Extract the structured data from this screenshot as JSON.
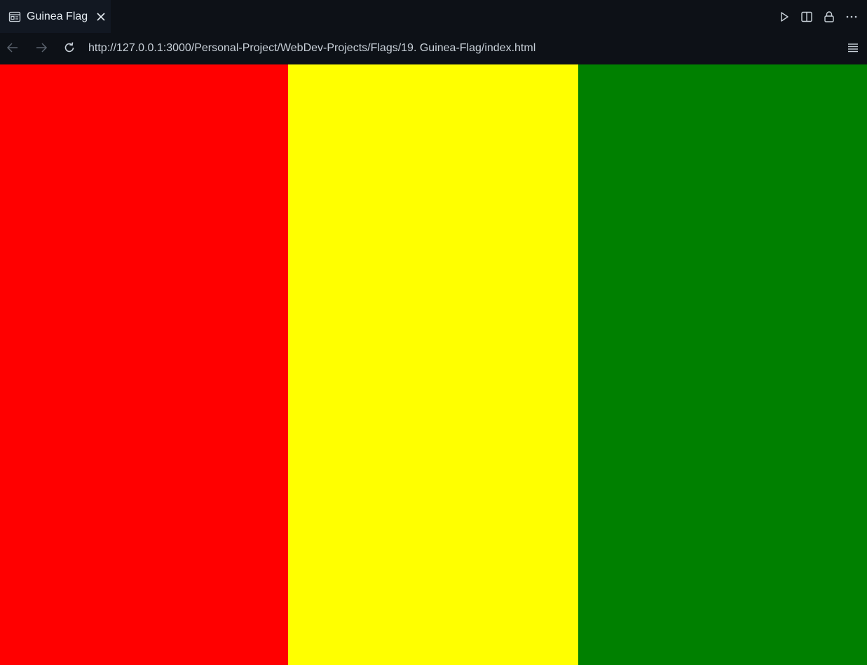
{
  "tab": {
    "title": "Guinea Flag",
    "icon": "preview-icon",
    "close_icon": "close-icon"
  },
  "tab_actions": [
    {
      "name": "run-icon"
    },
    {
      "name": "split-editor-icon"
    },
    {
      "name": "lock-icon"
    },
    {
      "name": "more-icon"
    }
  ],
  "nav": {
    "back_icon": "arrow-left-icon",
    "forward_icon": "arrow-right-icon",
    "reload_icon": "reload-icon",
    "url": "http://127.0.0.1:3000/Personal-Project/WebDev-Projects/Flags/19. Guinea-Flag/index.html",
    "menu_icon": "hamburger-menu-icon"
  },
  "flag": {
    "stripes": [
      {
        "color": "#ff0000"
      },
      {
        "color": "#ffff00"
      },
      {
        "color": "#008000"
      }
    ]
  },
  "colors": {
    "chrome_bg": "#0d1117",
    "tab_bg": "#121822",
    "text": "#e6edf3"
  }
}
